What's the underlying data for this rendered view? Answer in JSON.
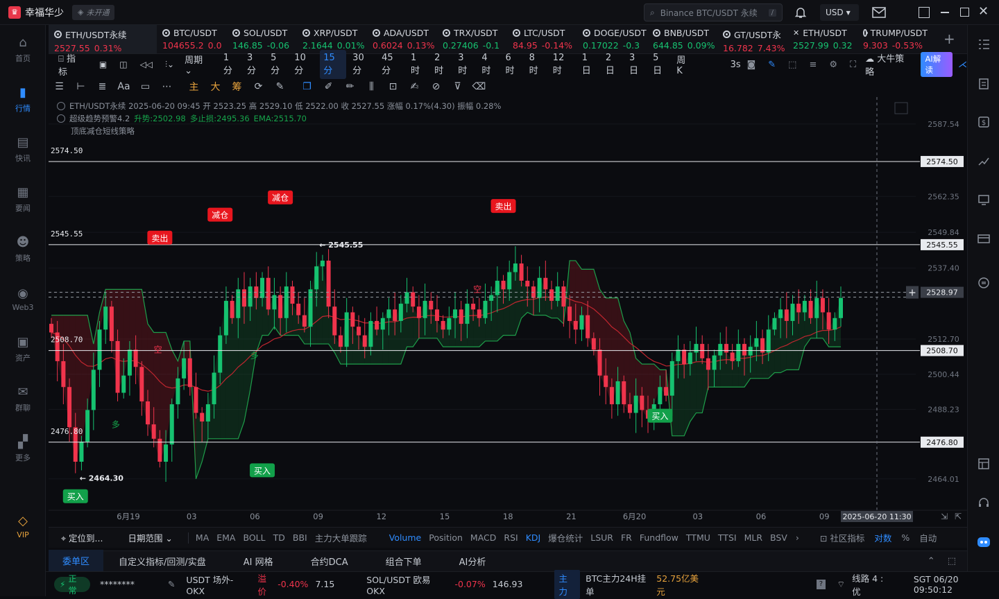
{
  "app": {
    "name": "幸福华少",
    "status": "未开通",
    "search_placeholder": "Binance BTC/USDT 永续",
    "search_shortcut": "/",
    "currency": "USD"
  },
  "nav": [
    {
      "label": "首页",
      "icon": "home-icon"
    },
    {
      "label": "行情",
      "icon": "chart-icon"
    },
    {
      "label": "快讯",
      "icon": "news-icon"
    },
    {
      "label": "要闻",
      "icon": "headline-icon"
    },
    {
      "label": "策略",
      "icon": "robot-icon"
    },
    {
      "label": "Web3",
      "icon": "web3-icon"
    },
    {
      "label": "资产",
      "icon": "wallet-icon"
    },
    {
      "label": "群聊",
      "icon": "chat-icon"
    },
    {
      "label": "更多",
      "icon": "grid-icon"
    },
    {
      "label": "VIP",
      "icon": "vip-icon"
    }
  ],
  "tickers": [
    {
      "name": "ETH/USDT永续",
      "price": "2527.55",
      "change": "0.31%",
      "dir": "up"
    },
    {
      "name": "BTC/USDT",
      "price": "104655.2",
      "change": "0.0",
      "dir": "up"
    },
    {
      "name": "SOL/USDT",
      "price": "146.85",
      "change": "-0.06",
      "dir": "down"
    },
    {
      "name": "XRP/USDT",
      "price": "2.1644",
      "change": "0.01%",
      "dir": "down"
    },
    {
      "name": "ADA/USDT",
      "price": "0.6024",
      "change": "0.13%",
      "dir": "up"
    },
    {
      "name": "TRX/USDT",
      "price": "0.27406",
      "change": "-0.1",
      "dir": "down"
    },
    {
      "name": "LTC/USDT",
      "price": "84.95",
      "change": "-0.14%",
      "dir": "up"
    },
    {
      "name": "DOGE/USDT",
      "price": "0.17022",
      "change": "-0.3",
      "dir": "down"
    },
    {
      "name": "BNB/USDT",
      "price": "644.85",
      "change": "0.09%",
      "dir": "down"
    },
    {
      "name": "GT/USDT永",
      "price": "16.782",
      "change": "7.43%",
      "dir": "up"
    },
    {
      "name": "ETH/USDT",
      "price": "2527.99",
      "change": "0.32",
      "dir": "down"
    },
    {
      "name": "TRUMP/USDT",
      "price": "9.303",
      "change": "-0.53%",
      "dir": "up"
    }
  ],
  "timeframes": {
    "indicator_label": "指标",
    "period_label": "周期",
    "items": [
      "1分",
      "3分",
      "5分",
      "10分",
      "15分",
      "30分",
      "45分",
      "1时",
      "2时",
      "3时",
      "4时",
      "6时",
      "8时",
      "12时",
      "1日",
      "2日",
      "3日",
      "5日",
      "周K"
    ],
    "active": "15分",
    "refresh": "3s",
    "strategy": "大牛策略",
    "ai_button": "AI解读"
  },
  "drawing_tools": {
    "main_label": "主",
    "big_label": "大",
    "chip_label": "筹",
    "text_label": "Aa"
  },
  "chart_header": {
    "line1": "ETH/USDT永续 2025-06-20 09:45 开 2523.25 高 2529.10 低 2522.00 收 2527.55 涨幅 0.17%(4.30) 振幅 0.28%",
    "line2a": "超级趋势预警4.2",
    "line2b": "升势:2502.98",
    "line2c": "多止损:2495.36",
    "line2d": "EMA:2515.70",
    "line3": "顶底减仓短线策略"
  },
  "chart_data": {
    "type": "candlestick",
    "symbol": "ETH/USDT永续",
    "interval": "15分",
    "ylim": [
      2456,
      2595
    ],
    "y_ticks": [
      "2587.54",
      "2574.50",
      "2562.35",
      "2549.84",
      "2545.55",
      "2537.40",
      "2528.97",
      "2512.70",
      "2508.70",
      "2500.44",
      "2488.23",
      "2476.80",
      "2464.01"
    ],
    "x_ticks": [
      "6月19",
      "03",
      "06",
      "09",
      "12",
      "15",
      "18",
      "21",
      "6月20",
      "03",
      "06",
      "09"
    ],
    "crosshair_time": "2025-06-20 11:30",
    "current_price": "2528.97",
    "levels": [
      {
        "value": 2574.5,
        "label": "2574.50"
      },
      {
        "value": 2545.55,
        "label": "2545.55"
      },
      {
        "value": 2508.7,
        "label": "2508.70"
      },
      {
        "value": 2476.8,
        "label": "2476.80"
      }
    ],
    "marks": [
      {
        "type": "high",
        "value": "2545.55"
      },
      {
        "type": "low",
        "value": "2464.30"
      }
    ],
    "signals": [
      {
        "label": "卖出",
        "kind": "sell"
      },
      {
        "label": "减仓",
        "kind": "reduce"
      },
      {
        "label": "减仓",
        "kind": "reduce"
      },
      {
        "label": "卖出",
        "kind": "sell"
      },
      {
        "label": "买入",
        "kind": "buy"
      },
      {
        "label": "买入",
        "kind": "buy"
      },
      {
        "label": "买入",
        "kind": "buy"
      }
    ],
    "trend_labels": {
      "up": "多",
      "down": "空"
    },
    "series_close": [
      2515,
      2505,
      2496,
      2482,
      2470,
      2477,
      2488,
      2502,
      2516,
      2524,
      2512,
      2494,
      2500,
      2509,
      2503,
      2491,
      2483,
      2478,
      2470,
      2476,
      2490,
      2499,
      2506,
      2496,
      2487,
      2484,
      2490,
      2501,
      2514,
      2526,
      2520,
      2530,
      2524,
      2531,
      2527,
      2534,
      2523,
      2528,
      2520,
      2531,
      2525,
      2521,
      2517,
      2530,
      2538,
      2540,
      2524,
      2514,
      2510,
      2522,
      2517,
      2514,
      2510,
      2519,
      2516,
      2520,
      2523,
      2519,
      2525,
      2529,
      2524,
      2520,
      2526,
      2523,
      2519,
      2516,
      2520,
      2523,
      2518,
      2525,
      2523,
      2520,
      2526,
      2528,
      2533,
      2530,
      2536,
      2539,
      2533,
      2531,
      2527,
      2534,
      2530,
      2526,
      2531,
      2524,
      2519,
      2516,
      2521,
      2513,
      2509,
      2500,
      2496,
      2490,
      2498,
      2490,
      2487,
      2493,
      2488,
      2485,
      2490,
      2496,
      2493,
      2505,
      2509,
      2504,
      2508,
      2511,
      2506,
      2502,
      2507,
      2511,
      2508,
      2505,
      2511,
      2507,
      2510,
      2513,
      2508,
      2516,
      2520,
      2523,
      2519,
      2525,
      2522,
      2526,
      2520,
      2527,
      2522,
      2516,
      2520,
      2527
    ]
  },
  "indicators": {
    "locate": "定位到...",
    "range": "日期范围",
    "items": [
      "MA",
      "EMA",
      "BOLL",
      "TD",
      "BBI",
      "主力大单跟踪",
      "Volume",
      "Position",
      "MACD",
      "RSI",
      "KDJ",
      "爆仓统计",
      "LSUR",
      "FR",
      "Fundflow",
      "TTMU",
      "TTSI",
      "MLR",
      "BSV"
    ],
    "community": "社区指标",
    "log_label": "对数",
    "pct_label": "%",
    "auto_label": "自动"
  },
  "bottom_tabs": [
    "委单区",
    "自定义指标/回测/实盘",
    "AI 网格",
    "合约DCA",
    "组合下单",
    "AI分析"
  ],
  "status": {
    "state": "正常",
    "user": "********",
    "u1": "USDT 场外-OKX",
    "u1_tag": "溢价",
    "u1_pct": "-0.40%",
    "u1_val": "7.15",
    "u2": "SOL/USDT 欧易OKX",
    "u2_pct": "-0.07%",
    "u2_val": "146.93",
    "main_tag": "主力",
    "main_text": "BTC主力24H挂单",
    "main_val": "52.75亿美元",
    "line": "线路 4 : 优",
    "time": "SGT 06/20 09:50:12"
  },
  "colors": {
    "up": "#16c270",
    "down": "#f0344c",
    "accent": "#2f8cff",
    "bg": "#0b0c10"
  }
}
